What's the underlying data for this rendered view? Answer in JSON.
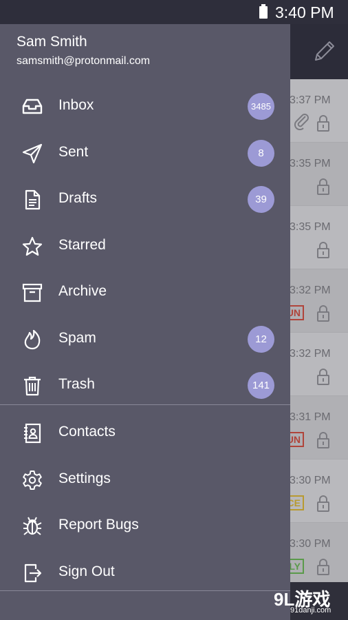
{
  "status_bar": {
    "time": "3:40 PM"
  },
  "background_list": {
    "rows": [
      {
        "time": "3:37 PM",
        "tag": "",
        "tag_color": "",
        "attachment": true
      },
      {
        "time": "3:35 PM",
        "tag": "",
        "tag_color": "",
        "attachment": false
      },
      {
        "time": "3:35 PM",
        "tag": "",
        "tag_color": "",
        "attachment": false
      },
      {
        "time": "3:32 PM",
        "tag": "UN",
        "tag_color": "#b0443a",
        "attachment": false
      },
      {
        "time": "3:32 PM",
        "tag": "",
        "tag_color": "",
        "attachment": false
      },
      {
        "time": "3:31 PM",
        "tag": "UN",
        "tag_color": "#b0443a",
        "attachment": false
      },
      {
        "time": "3:30 PM",
        "tag": "CE",
        "tag_color": "#b89a30",
        "attachment": false
      },
      {
        "time": "3:30 PM",
        "tag": "LY",
        "tag_color": "#5a9a4a",
        "attachment": false
      }
    ]
  },
  "drawer": {
    "user": {
      "name": "Sam Smith",
      "email": "samsmith@protonmail.com"
    },
    "primary_items": [
      {
        "label": "Inbox",
        "icon": "inbox-icon",
        "badge": "3485"
      },
      {
        "label": "Sent",
        "icon": "send-icon",
        "badge": "8"
      },
      {
        "label": "Drafts",
        "icon": "draft-document-icon",
        "badge": "39"
      },
      {
        "label": "Starred",
        "icon": "star-icon",
        "badge": ""
      },
      {
        "label": "Archive",
        "icon": "archive-box-icon",
        "badge": ""
      },
      {
        "label": "Spam",
        "icon": "flame-icon",
        "badge": "12"
      },
      {
        "label": "Trash",
        "icon": "trash-icon",
        "badge": "141"
      }
    ],
    "secondary_items": [
      {
        "label": "Contacts",
        "icon": "contacts-book-icon"
      },
      {
        "label": "Settings",
        "icon": "gear-icon"
      },
      {
        "label": "Report Bugs",
        "icon": "bug-icon"
      },
      {
        "label": "Sign Out",
        "icon": "sign-out-icon"
      }
    ]
  },
  "watermark": {
    "logo": "9L游戏",
    "url": "91danji.com"
  },
  "colors": {
    "drawer_bg": "#595868",
    "badge": "#9c9ad5",
    "status_bar": "#2e2e3b"
  }
}
